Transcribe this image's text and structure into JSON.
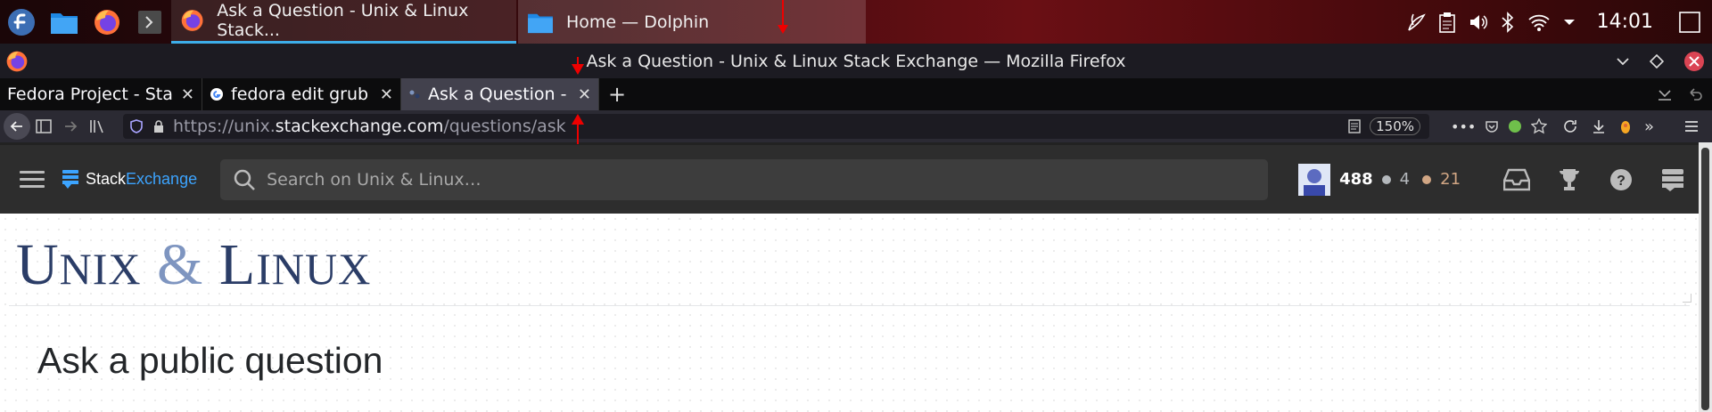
{
  "taskbar": {
    "tasks": [
      {
        "label": "Ask a Question - Unix & Linux Stack..."
      },
      {
        "label": "Home — Dolphin"
      }
    ],
    "clock": "14:01"
  },
  "window": {
    "title": "Ask a Question - Unix & Linux Stack Exchange — Mozilla Firefox"
  },
  "tabs": [
    {
      "label": "Fedora Project - Start"
    },
    {
      "label": "fedora edit grub m"
    },
    {
      "label": "Ask a Question - Ur"
    }
  ],
  "navbar": {
    "url_prefix": "https://unix.",
    "url_domain": "stackexchange.com",
    "url_path": "/questions/ask",
    "zoom": "150%"
  },
  "se": {
    "logo_stack": "Stack",
    "logo_exchange": "Exchange",
    "search_placeholder": "Search on Unix & Linux…",
    "reputation": "488",
    "silver_count": "4",
    "bronze_count": "21"
  },
  "page": {
    "site_logo_u": "U",
    "site_logo_nix": "NIX",
    "site_logo_amp": "&",
    "site_logo_l": "L",
    "site_logo_inux": "INUX",
    "heading": "Ask a public question"
  },
  "colors": {
    "se_blue": "#3ca4ff",
    "logo_navy": "#2b3d67",
    "silver": "#b4b8bc",
    "bronze": "#d1a684",
    "taskbar_accent": "#3daee9"
  }
}
